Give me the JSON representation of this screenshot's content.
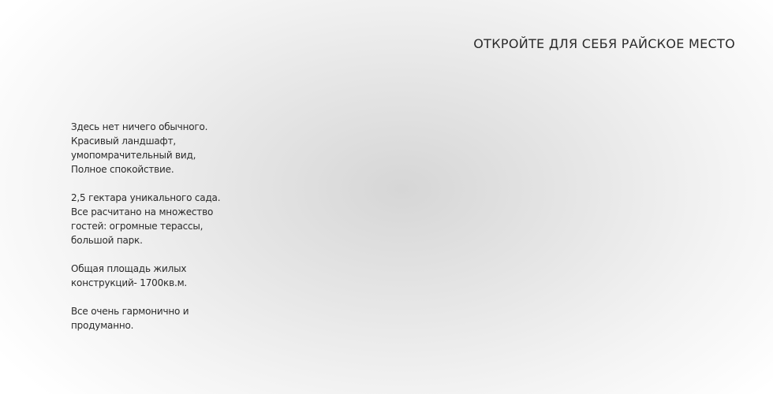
{
  "header": {
    "headline": "ОТКРОЙТЕ ДЛЯ СЕБЯ РАЙСКОЕ МЕСТО"
  },
  "description": {
    "paragraphs": [
      {
        "lines": [
          "Здесь нет ничего обычного.",
          "Красивый ландшафт,",
          "умопомрачительный вид,",
          "Полное спокойствие."
        ]
      },
      {
        "lines": [
          "2,5 гектара уникального сада.",
          "Все расчитано на множество",
          "гостей: огромные терассы,",
          "большой парк."
        ]
      },
      {
        "lines": [
          "Общая площадь жилых",
          "конструкций- 1700кв.м."
        ]
      },
      {
        "lines": [
          "Все очень гармонично и",
          "продуманно."
        ]
      }
    ]
  }
}
